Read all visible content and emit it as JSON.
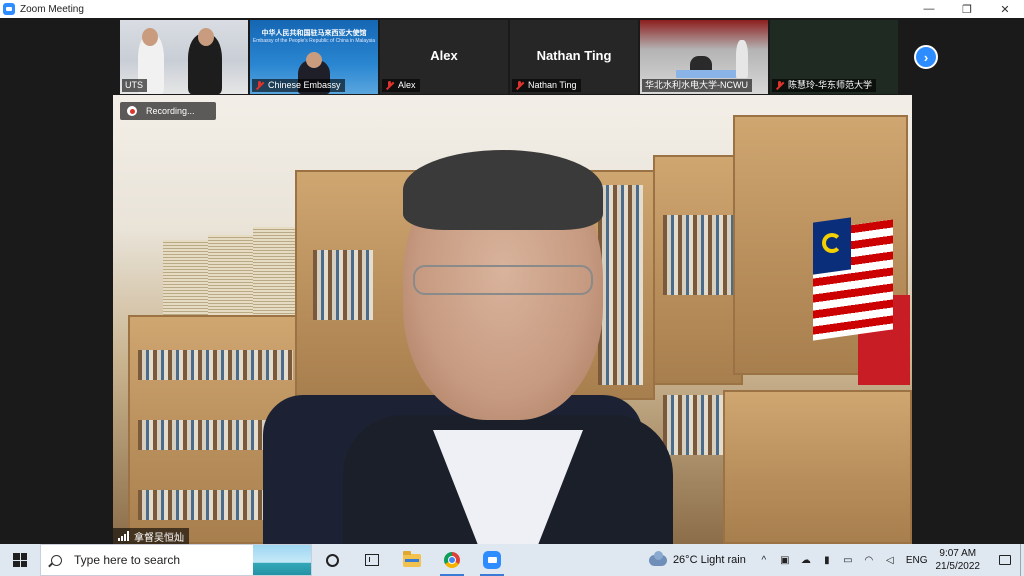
{
  "window": {
    "title": "Zoom Meeting",
    "controls": {
      "minimize": "—",
      "restore": "❐",
      "close": "✕"
    }
  },
  "thumbnails": [
    {
      "label": "UTS",
      "muted": false,
      "video": true,
      "big_name": ""
    },
    {
      "label": "Chinese Embassy",
      "muted": true,
      "video": true,
      "big_name": "",
      "banner_title": "中华人民共和国驻马来西亚大使馆",
      "banner_subtitle": "Embassy of the People's Republic of China in Malaysia"
    },
    {
      "label": "Alex",
      "muted": true,
      "video": false,
      "big_name": "Alex"
    },
    {
      "label": "Nathan Ting",
      "muted": true,
      "video": false,
      "big_name": "Nathan Ting"
    },
    {
      "label": "华北水利水电大学-NCWU",
      "muted": false,
      "video": true,
      "big_name": ""
    },
    {
      "label": "陈慧玲-华东师范大学",
      "muted": true,
      "video": true,
      "big_name": ""
    }
  ],
  "next_page_glyph": "›",
  "recording": {
    "text": "Recording..."
  },
  "active_speaker": {
    "name": "拿督吴恒灿"
  },
  "taskbar": {
    "search_placeholder": "Type here to search",
    "weather": "26°C  Light rain",
    "language": "ENG",
    "time": "9:07 AM",
    "date": "21/5/2022",
    "tray_chevron": "^"
  },
  "colors": {
    "zoom_blue": "#2d8cff",
    "muted_red": "#e0332c",
    "taskbar_bg": "#dfe7f1"
  }
}
